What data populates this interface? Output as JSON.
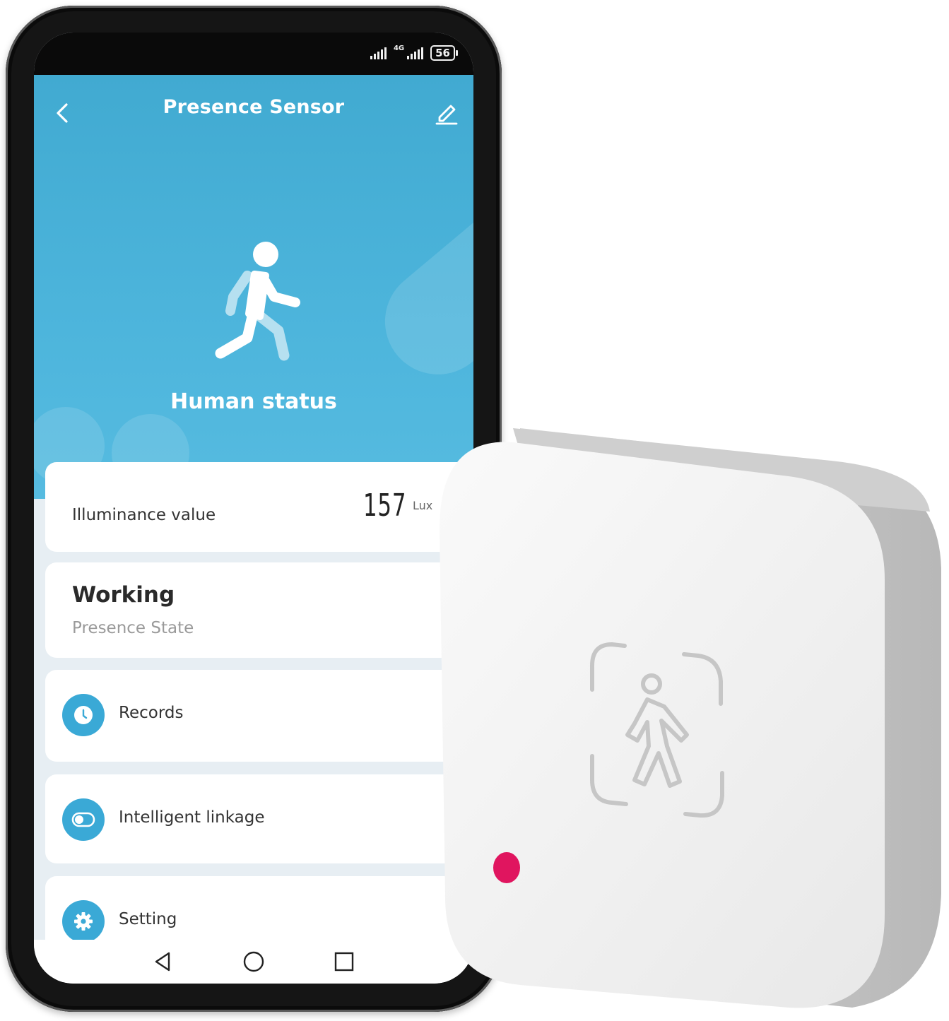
{
  "status_bar": {
    "network_label": "4G",
    "battery_level": "56"
  },
  "header": {
    "title": "Presence Sensor",
    "back_icon": "chevron-left-icon",
    "edit_icon": "pencil-icon"
  },
  "hero": {
    "icon": "walking-person-icon",
    "label": "Human status"
  },
  "illuminance": {
    "label": "Illuminance value",
    "value": "157",
    "unit": "Lux"
  },
  "presence": {
    "value": "Working",
    "label": "Presence State"
  },
  "menu": {
    "records": {
      "label": "Records",
      "icon": "clock-icon"
    },
    "linkage": {
      "label": "Intelligent linkage",
      "icon": "toggle-icon"
    },
    "setting": {
      "label": "Setting",
      "icon": "gear-icon"
    }
  },
  "nav": {
    "back": "triangle-back-icon",
    "home": "circle-home-icon",
    "recents": "square-recents-icon"
  },
  "colors": {
    "accent": "#41aad1",
    "card_icon": "#3aa9d6",
    "led": "#e0155f"
  }
}
